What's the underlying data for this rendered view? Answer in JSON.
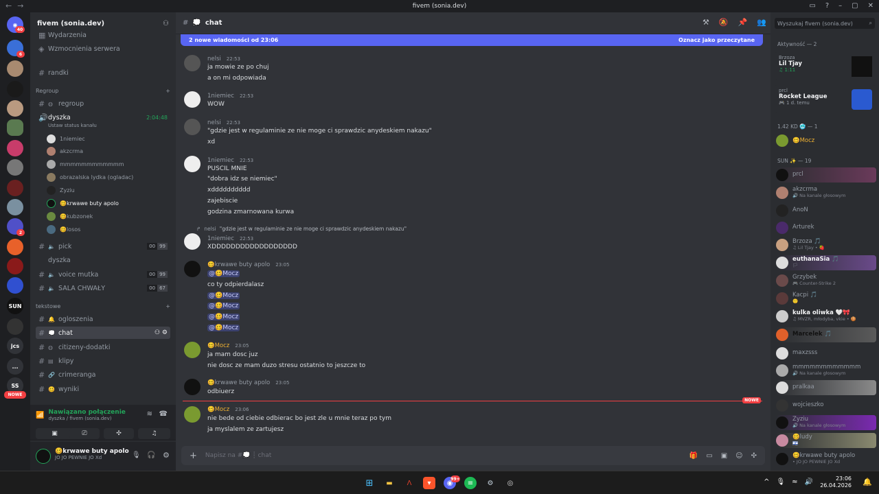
{
  "window": {
    "title": "fivem (sonia.dev)"
  },
  "guilds": {
    "home_badge": "40",
    "badges": [
      {
        "label": "6"
      },
      {
        "label": "2"
      }
    ],
    "text_icons": [
      "SUN",
      "jcs",
      "...",
      "SS"
    ],
    "nowe_label": "NOWE"
  },
  "server": {
    "name": "fivem (sonia.dev)"
  },
  "channels": {
    "top_items": [
      {
        "label": "Wydarzenia"
      },
      {
        "label": "Wzmocnienia serwera"
      }
    ],
    "randki": "randki",
    "cat_regroup": "Regroup",
    "regroup": "regroup",
    "dyszka": "dyszka",
    "dyszka_timer": "2:04:48",
    "dyszka_status": "Ustaw status kanału",
    "voice_users": [
      "1niemiec",
      "akzcrma",
      "mmmmmmmmmmmm",
      "obrazalska lydka (ogladac)",
      "Zyziu",
      "🥴krwawe buty apolo",
      "🥴kubzonek",
      "🥴losos"
    ],
    "pick": "pick",
    "pick_counts": [
      "00",
      "99"
    ],
    "dyszka2": "dyszka",
    "voice_mutka": "voice mutka",
    "voice_mutka_counts": [
      "00",
      "99"
    ],
    "sala": "SALA CHWAŁY",
    "sala_counts": [
      "00",
      "67"
    ],
    "cat_tekstowe": "tekstowe",
    "ogloszenia": "ogloszenia",
    "chat": "chat",
    "citizeny": "citizeny-dodatki",
    "klipy": "klipy",
    "crimeranga": "crimeranga",
    "wyniki": "wyniki"
  },
  "voice_panel": {
    "status": "Nawiązano połączenie",
    "location": "dyszka / fivem (sonia.dev)"
  },
  "user": {
    "name": "🥴krwawe buty apolo",
    "status": "JO JO PEWNIE JO Xd"
  },
  "chat_header": {
    "name": "chat",
    "search_placeholder": "Wyszukaj fivem (sonia.dev)"
  },
  "new_messages": {
    "text": "2 nowe wiadomości od 23:06",
    "action": "Oznacz jako przeczytane"
  },
  "messages": [
    {
      "author": "nelsi",
      "time": "22:53",
      "lines": [
        "ja mowie ze po chuj",
        "a on mi odpowiada"
      ]
    },
    {
      "author": "1niemiec",
      "time": "22:53",
      "lines": [
        "WOW"
      ]
    },
    {
      "author": "nelsi",
      "time": "22:53",
      "lines": [
        "\"gdzie jest w regulaminie ze nie moge ci sprawdzic anydeskiem nakazu\"",
        "xd"
      ]
    },
    {
      "author": "1niemiec",
      "time": "22:53",
      "lines": [
        "PUSCIL MNIE",
        "\"dobra idz se niemiec\"",
        "xdddddddddd",
        "zajebiscie",
        "godzina zmarnowana kurwa"
      ]
    },
    {
      "reply_author": "nelsi",
      "reply_text": "\"gdzie jest w regulaminie ze nie moge ci sprawdzic anydeskiem nakazu\"",
      "author": "1niemiec",
      "time": "22:53",
      "lines": [
        "XDDDDDDDDDDDDDDDDDD"
      ]
    },
    {
      "author": "🥴krwawe buty apolo",
      "time": "23:05",
      "mention": "@🥴Mocz",
      "lines": [
        "co ty odpierdalasz"
      ]
    },
    {
      "author": "🥴Mocz",
      "time": "23:05",
      "lines": [
        "ja mam dosc juz",
        "nie dosc ze mam duzo stresu ostatnio to jeszcze to"
      ]
    },
    {
      "author": "🥴krwawe buty apolo",
      "time": "23:05",
      "lines": [
        "odbiuerz"
      ]
    },
    {
      "author": "🥴Mocz",
      "time": "23:06",
      "lines": [
        "nie bede od ciebie odbierac bo jest zle u mnie teraz po tym",
        "ja myslalem ze zartujesz"
      ]
    }
  ],
  "nowe_divider": "NOWE",
  "composer": {
    "placeholder": "Napisz na #💭 ┊ chat"
  },
  "members": {
    "activity_header": "Aktywność — 2",
    "activities": [
      {
        "user": "Brzoza",
        "title": "Lil Tjay",
        "sub": "♫ 1:11"
      },
      {
        "user": "prcl",
        "title": "Rocket League",
        "sub": "🎮 1 d. temu"
      }
    ],
    "role1": "1.42 KD 🥶 — 1",
    "role1_members": [
      {
        "name": "🥴Mocz",
        "sub": ""
      }
    ],
    "role2": "SUN ✨ — 19",
    "role2_members": [
      {
        "name": "prcl",
        "sub": ""
      },
      {
        "name": "akzcrma",
        "sub": "🔊 Na kanale głosowym"
      },
      {
        "name": "AnoN",
        "sub": ""
      },
      {
        "name": "Arturek",
        "sub": ""
      },
      {
        "name": "Brzoza 🎵",
        "sub": "♫ Lil Tjay • 🍓"
      },
      {
        "name": "euthanaSia 🎵",
        "sub": "🏳"
      },
      {
        "name": "Grzybek",
        "sub": "🎮 Counter-Strike 2"
      },
      {
        "name": "Kacpi 🎵",
        "sub": "🙂"
      },
      {
        "name": "kulka oliwka 🤍🎀",
        "sub": "♫ MVZR, młodyba, vkie • 🍪"
      },
      {
        "name": "Marcelek 🎵",
        "sub": ""
      },
      {
        "name": "maxzsss",
        "sub": ""
      },
      {
        "name": "mmmmmmmmmmmm",
        "sub": "🔊 Na kanale głosowym"
      },
      {
        "name": "pralkaa",
        "sub": ""
      },
      {
        "name": "wojcieszko",
        "sub": ""
      },
      {
        "name": "Zyziu",
        "sub": "🔊 Na kanale głosowym"
      },
      {
        "name": "🥴ludy",
        "sub": "🇮🇱"
      },
      {
        "name": "🥴krwawe buty apolo",
        "sub": "• JO JO PEWNIE JO Xd"
      }
    ]
  },
  "taskbar": {
    "time": "23:06",
    "date": "26.04.2026",
    "badge": "99+"
  }
}
